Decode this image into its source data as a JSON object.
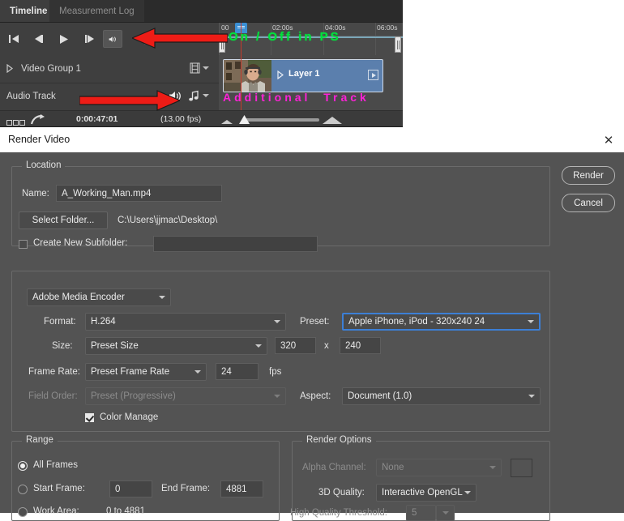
{
  "timeline": {
    "tabs": [
      {
        "label": "Timeline",
        "active": true
      },
      {
        "label": "Measurement Log",
        "active": false
      }
    ],
    "transport": {
      "go_to_first_frame": "go-to-first-frame",
      "previous_frame": "previous-frame",
      "play": "play",
      "next_frame": "next-frame",
      "audio": "mute-audio"
    },
    "ruler_ticks": [
      "00",
      "02:00s",
      "04:00s",
      "06:00s"
    ],
    "rows": [
      {
        "label": "Video Group 1"
      },
      {
        "label": "Audio Track"
      }
    ],
    "clip": {
      "name": "Layer 1"
    },
    "status": {
      "timecode": "0:00:47:01",
      "fps": "(13.00 fps)"
    },
    "annotations": [
      {
        "text": "On / Off in PS",
        "color": "#00e03c"
      },
      {
        "text": "Additional  Track",
        "color": "#ff21d8"
      }
    ]
  },
  "dialog": {
    "title": "Render Video",
    "close_label": "✕",
    "buttons": {
      "render": "Render",
      "cancel": "Cancel"
    },
    "location": {
      "group_title": "Location",
      "name_label": "Name:",
      "name_value": "A_Working_Man.mp4",
      "select_folder_button": "Select Folder...",
      "folder_path": "C:\\Users\\jjmac\\Desktop\\",
      "create_subfolder_label": "Create New Subfolder:",
      "create_subfolder_checked": false,
      "subfolder_value": ""
    },
    "encoder": {
      "engine": "Adobe Media Encoder",
      "format_label": "Format:",
      "format_value": "H.264",
      "preset_label": "Preset:",
      "preset_value": "Apple iPhone, iPod - 320x240 24",
      "size_label": "Size:",
      "size_value": "Preset Size",
      "width": "320",
      "size_separator": "x",
      "height": "240",
      "frame_rate_label": "Frame Rate:",
      "frame_rate_value": "Preset Frame Rate",
      "fps_value": "24",
      "fps_units": "fps",
      "field_order_label": "Field Order:",
      "field_order_value": "Preset (Progressive)",
      "aspect_label": "Aspect:",
      "aspect_value": "Document (1.0)",
      "color_manage_label": "Color Manage",
      "color_manage_checked": true
    },
    "range": {
      "group_title": "Range",
      "all_frames_label": "All Frames",
      "all_frames_selected": true,
      "start_frame_label": "Start Frame:",
      "start_frame_value": "0",
      "end_frame_label": "End Frame:",
      "end_frame_value": "4881",
      "work_area_label": "Work Area:",
      "work_area_value": "0 to 4881"
    },
    "render_options": {
      "group_title": "Render Options",
      "alpha_channel_label": "Alpha Channel:",
      "alpha_channel_value": "None",
      "quality_3d_label": "3D Quality:",
      "quality_3d_value": "Interactive OpenGL",
      "hq_threshold_label": "High Quality Threshold:",
      "hq_threshold_value": "5"
    }
  },
  "colors": {
    "accent_blue": "#3c7fd6",
    "annotation_green": "#00e03c",
    "annotation_magenta": "#ff21d8",
    "arrow_red": "#ee1c16",
    "dialog_bg": "#535353",
    "panel_bg": "#424242"
  }
}
